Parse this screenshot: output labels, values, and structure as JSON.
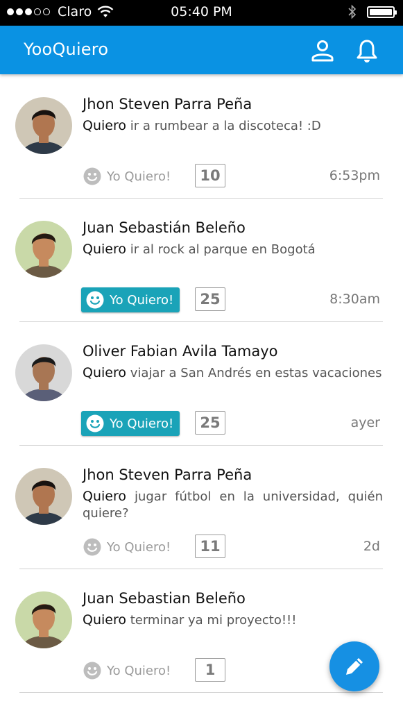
{
  "status_bar": {
    "carrier": "Claro",
    "time": "05:40 PM"
  },
  "app_bar": {
    "title": "YooQuiero",
    "icons": [
      "profile-icon",
      "bell-icon"
    ],
    "color": "#0a92e3"
  },
  "feed": [
    {
      "name": "Jhon Steven Parra Peña",
      "verb": "Quiero",
      "text": "ir a rumbear a la discoteca! :D",
      "button": "Yo Quiero!",
      "active": false,
      "count": "10",
      "time": "6:53pm"
    },
    {
      "name": "Juan Sebastián Beleño",
      "verb": "Quiero",
      "text": "ir al rock al parque en Bogotá",
      "button": "Yo Quiero!",
      "active": true,
      "count": "25",
      "time": "8:30am"
    },
    {
      "name": "Oliver Fabian Avila Tamayo",
      "verb": "Quiero",
      "text": "viajar a San Andrés en estas vacaciones",
      "button": "Yo Quiero!",
      "active": true,
      "count": "25",
      "time": "ayer"
    },
    {
      "name": "Jhon Steven Parra Peña",
      "verb": "Quiero",
      "text": "jugar fútbol en la universidad, quién quiere?",
      "button": "Yo Quiero!",
      "active": false,
      "count": "11",
      "time": "2d"
    },
    {
      "name": "Juan Sebastian Beleño",
      "verb": "Quiero",
      "text": "terminar ya mi proyecto!!!",
      "button": "Yo Quiero!",
      "active": false,
      "count": "1",
      "time": ""
    }
  ],
  "fab": {
    "icon": "pencil-icon",
    "color": "#1690e3"
  },
  "colors": {
    "active_button": "#1aa3b8",
    "inactive_text": "#9a9a9a"
  }
}
